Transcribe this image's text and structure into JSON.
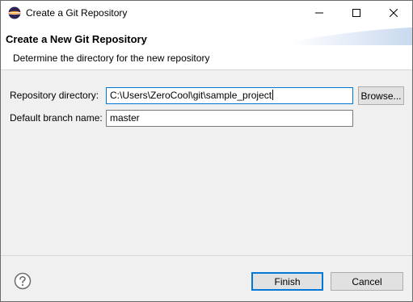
{
  "window": {
    "title": "Create a Git Repository",
    "icon": "eclipse-icon"
  },
  "titlebar_controls": {
    "minimize_icon": "minimize-icon",
    "maximize_icon": "maximize-icon",
    "close_icon": "close-icon"
  },
  "banner": {
    "title": "Create a New Git Repository",
    "description": "Determine the directory for the new repository"
  },
  "form": {
    "repository_directory": {
      "label": "Repository directory:",
      "value": "C:\\Users\\ZeroCool\\git\\sample_project"
    },
    "browse_label": "Browse...",
    "default_branch": {
      "label": "Default branch name:",
      "value": "master"
    }
  },
  "footer": {
    "help_icon": "help-icon",
    "finish_label": "Finish",
    "cancel_label": "Cancel"
  },
  "colors": {
    "focus_accent": "#0078d7",
    "dialog_background": "#f0f0f0"
  }
}
